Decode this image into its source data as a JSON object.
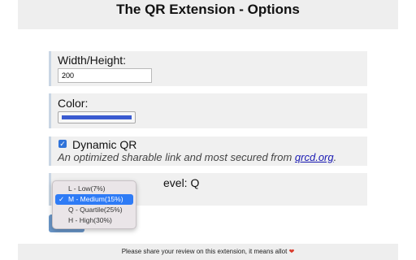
{
  "header": {
    "title": "The QR Extension - Options"
  },
  "size": {
    "label": "Width/Height:",
    "value": "200"
  },
  "color": {
    "label": "Color:",
    "swatch": "#3a5bd0"
  },
  "dynamic": {
    "label": "Dynamic QR",
    "checked": true,
    "description": "An optimized sharable link and most secured from ",
    "link": "qrcd.org",
    "suffix": "."
  },
  "error_correction": {
    "label_visible": "evel: Q",
    "options": [
      {
        "label": "L - Low(7%)",
        "selected": false
      },
      {
        "label": "M - Medium(15%)",
        "selected": true
      },
      {
        "label": "Q - Quartile(25%)",
        "selected": false
      },
      {
        "label": "H - High(30%)",
        "selected": false
      }
    ]
  },
  "footer": {
    "text": "Please share your review on this extension, it means allot",
    "heart": "❤"
  },
  "colors": {
    "accent": "#2e7bf6",
    "save_button": "#6a96c8"
  }
}
